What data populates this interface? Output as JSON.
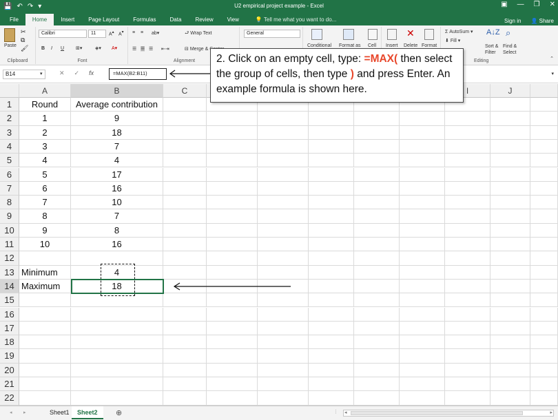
{
  "window": {
    "title": "U2 empirical project example - Excel",
    "controls": [
      "▣",
      "—",
      "❐",
      "✕"
    ]
  },
  "tabs": [
    "File",
    "Home",
    "Insert",
    "Page Layout",
    "Formulas",
    "Data",
    "Review",
    "View"
  ],
  "active_tab": "Home",
  "tell_me": "Tell me what you want to do...",
  "account": {
    "sign_in": "Sign in",
    "share": "Share"
  },
  "ribbon": {
    "clipboard": {
      "label": "Clipboard",
      "paste": "Paste"
    },
    "font": {
      "label": "Font",
      "name": "Calibri",
      "size": "11",
      "bold": "B",
      "italic": "I",
      "underline": "U"
    },
    "alignment": {
      "label": "Alignment",
      "wrap_text": "Wrap Text",
      "merge_center": "Merge & Center"
    },
    "number": {
      "format": "General"
    },
    "styles": {
      "conditional": "Conditional",
      "format_as": "Format as",
      "cell": "Cell"
    },
    "cells": {
      "insert": "Insert",
      "delete": "Delete",
      "format": "Format"
    },
    "editing": {
      "label": "Editing",
      "autosum": "AutoSum",
      "fill": "Fill",
      "sort_filter": "Sort &",
      "sort_filter2": "Filter",
      "find_select": "Find &",
      "find_select2": "Select"
    }
  },
  "formula_bar": {
    "name_box": "B14",
    "formula": "=MAX(B2:B11)"
  },
  "columns": [
    "A",
    "B",
    "C",
    "D",
    "E",
    "F",
    "G",
    "H",
    "I",
    "J"
  ],
  "rows": [
    [
      "Round",
      "Average contribution"
    ],
    [
      "1",
      "9"
    ],
    [
      "2",
      "18"
    ],
    [
      "3",
      "7"
    ],
    [
      "4",
      "4"
    ],
    [
      "5",
      "17"
    ],
    [
      "6",
      "16"
    ],
    [
      "7",
      "10"
    ],
    [
      "8",
      "7"
    ],
    [
      "9",
      "8"
    ],
    [
      "10",
      "16"
    ],
    [
      "",
      ""
    ],
    [
      "Minimum",
      "4"
    ],
    [
      "Maximum",
      "18"
    ],
    [
      "",
      ""
    ],
    [
      "",
      ""
    ],
    [
      "",
      ""
    ],
    [
      "",
      ""
    ],
    [
      "",
      ""
    ],
    [
      "",
      ""
    ],
    [
      "",
      ""
    ],
    [
      "",
      ""
    ]
  ],
  "sheets": [
    "Sheet1",
    "Sheet2"
  ],
  "active_sheet": "Sheet2",
  "callout": {
    "part1": "2. Click on an empty cell, type: ",
    "red1": "=MAX(",
    "part2": "  then select the group of cells, then type ",
    "red2": ")",
    "part3": " and press Enter. An example formula is shown here."
  }
}
